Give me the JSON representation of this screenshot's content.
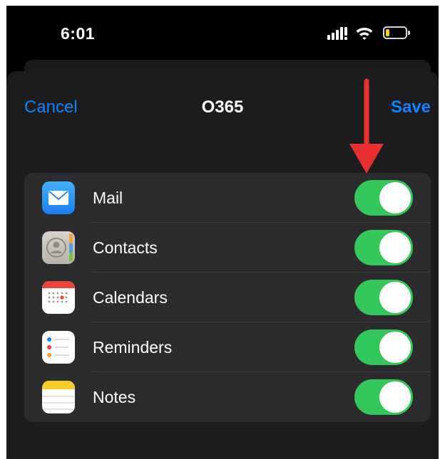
{
  "status_bar": {
    "time": "6:01",
    "battery_level": 0.2
  },
  "nav": {
    "cancel_label": "Cancel",
    "title": "O365",
    "save_label": "Save"
  },
  "colors": {
    "accent": "#0a84ff",
    "toggle_on": "#34c759",
    "annotation_arrow": "#e8302f"
  },
  "services": [
    {
      "label": "Mail",
      "icon": "mail-icon",
      "enabled": true
    },
    {
      "label": "Contacts",
      "icon": "contacts-icon",
      "enabled": true
    },
    {
      "label": "Calendars",
      "icon": "calendar-icon",
      "enabled": true
    },
    {
      "label": "Reminders",
      "icon": "reminders-icon",
      "enabled": true
    },
    {
      "label": "Notes",
      "icon": "notes-icon",
      "enabled": true
    }
  ]
}
